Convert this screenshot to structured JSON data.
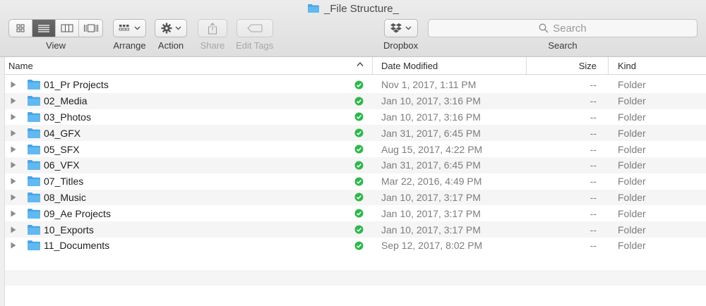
{
  "window": {
    "title": "_File Structure_",
    "icon": "folder-icon"
  },
  "toolbar": {
    "view_label": "View",
    "view_modes": [
      "icon-view",
      "list-view",
      "column-view",
      "cover-flow-view"
    ],
    "view_active": "list-view",
    "arrange_label": "Arrange",
    "action_label": "Action",
    "share_label": "Share",
    "edit_tags_label": "Edit Tags",
    "dropbox_label": "Dropbox",
    "search_label": "Search",
    "search_placeholder": "Search"
  },
  "columns": {
    "name": "Name",
    "date_modified": "Date Modified",
    "size": "Size",
    "kind": "Kind",
    "sort": "name-ascending"
  },
  "files": [
    {
      "name": "01_Pr Projects",
      "date": "Nov 1, 2017, 1:11 PM",
      "size": "--",
      "kind": "Folder",
      "sync": "synced"
    },
    {
      "name": "02_Media",
      "date": "Jan 10, 2017, 3:16 PM",
      "size": "--",
      "kind": "Folder",
      "sync": "synced"
    },
    {
      "name": "03_Photos",
      "date": "Jan 10, 2017, 3:16 PM",
      "size": "--",
      "kind": "Folder",
      "sync": "synced"
    },
    {
      "name": "04_GFX",
      "date": "Jan 31, 2017, 6:45 PM",
      "size": "--",
      "kind": "Folder",
      "sync": "synced"
    },
    {
      "name": "05_SFX",
      "date": "Aug 15, 2017, 4:22 PM",
      "size": "--",
      "kind": "Folder",
      "sync": "synced"
    },
    {
      "name": "06_VFX",
      "date": "Jan 31, 2017, 6:45 PM",
      "size": "--",
      "kind": "Folder",
      "sync": "synced"
    },
    {
      "name": "07_Titles",
      "date": "Mar 22, 2016, 4:49 PM",
      "size": "--",
      "kind": "Folder",
      "sync": "synced"
    },
    {
      "name": "08_Music",
      "date": "Jan 10, 2017, 3:17 PM",
      "size": "--",
      "kind": "Folder",
      "sync": "synced"
    },
    {
      "name": "09_Ae Projects",
      "date": "Jan 10, 2017, 3:17 PM",
      "size": "--",
      "kind": "Folder",
      "sync": "synced"
    },
    {
      "name": "10_Exports",
      "date": "Jan 10, 2017, 3:17 PM",
      "size": "--",
      "kind": "Folder",
      "sync": "synced"
    },
    {
      "name": "11_Documents",
      "date": "Sep 12, 2017, 8:02 PM",
      "size": "--",
      "kind": "Folder",
      "sync": "synced"
    }
  ],
  "colors": {
    "folder_blue": "#62b8f0",
    "folder_blue_dark": "#4aa4e2",
    "sync_green": "#2db84b",
    "row_stripe": "#f5f5f5"
  }
}
